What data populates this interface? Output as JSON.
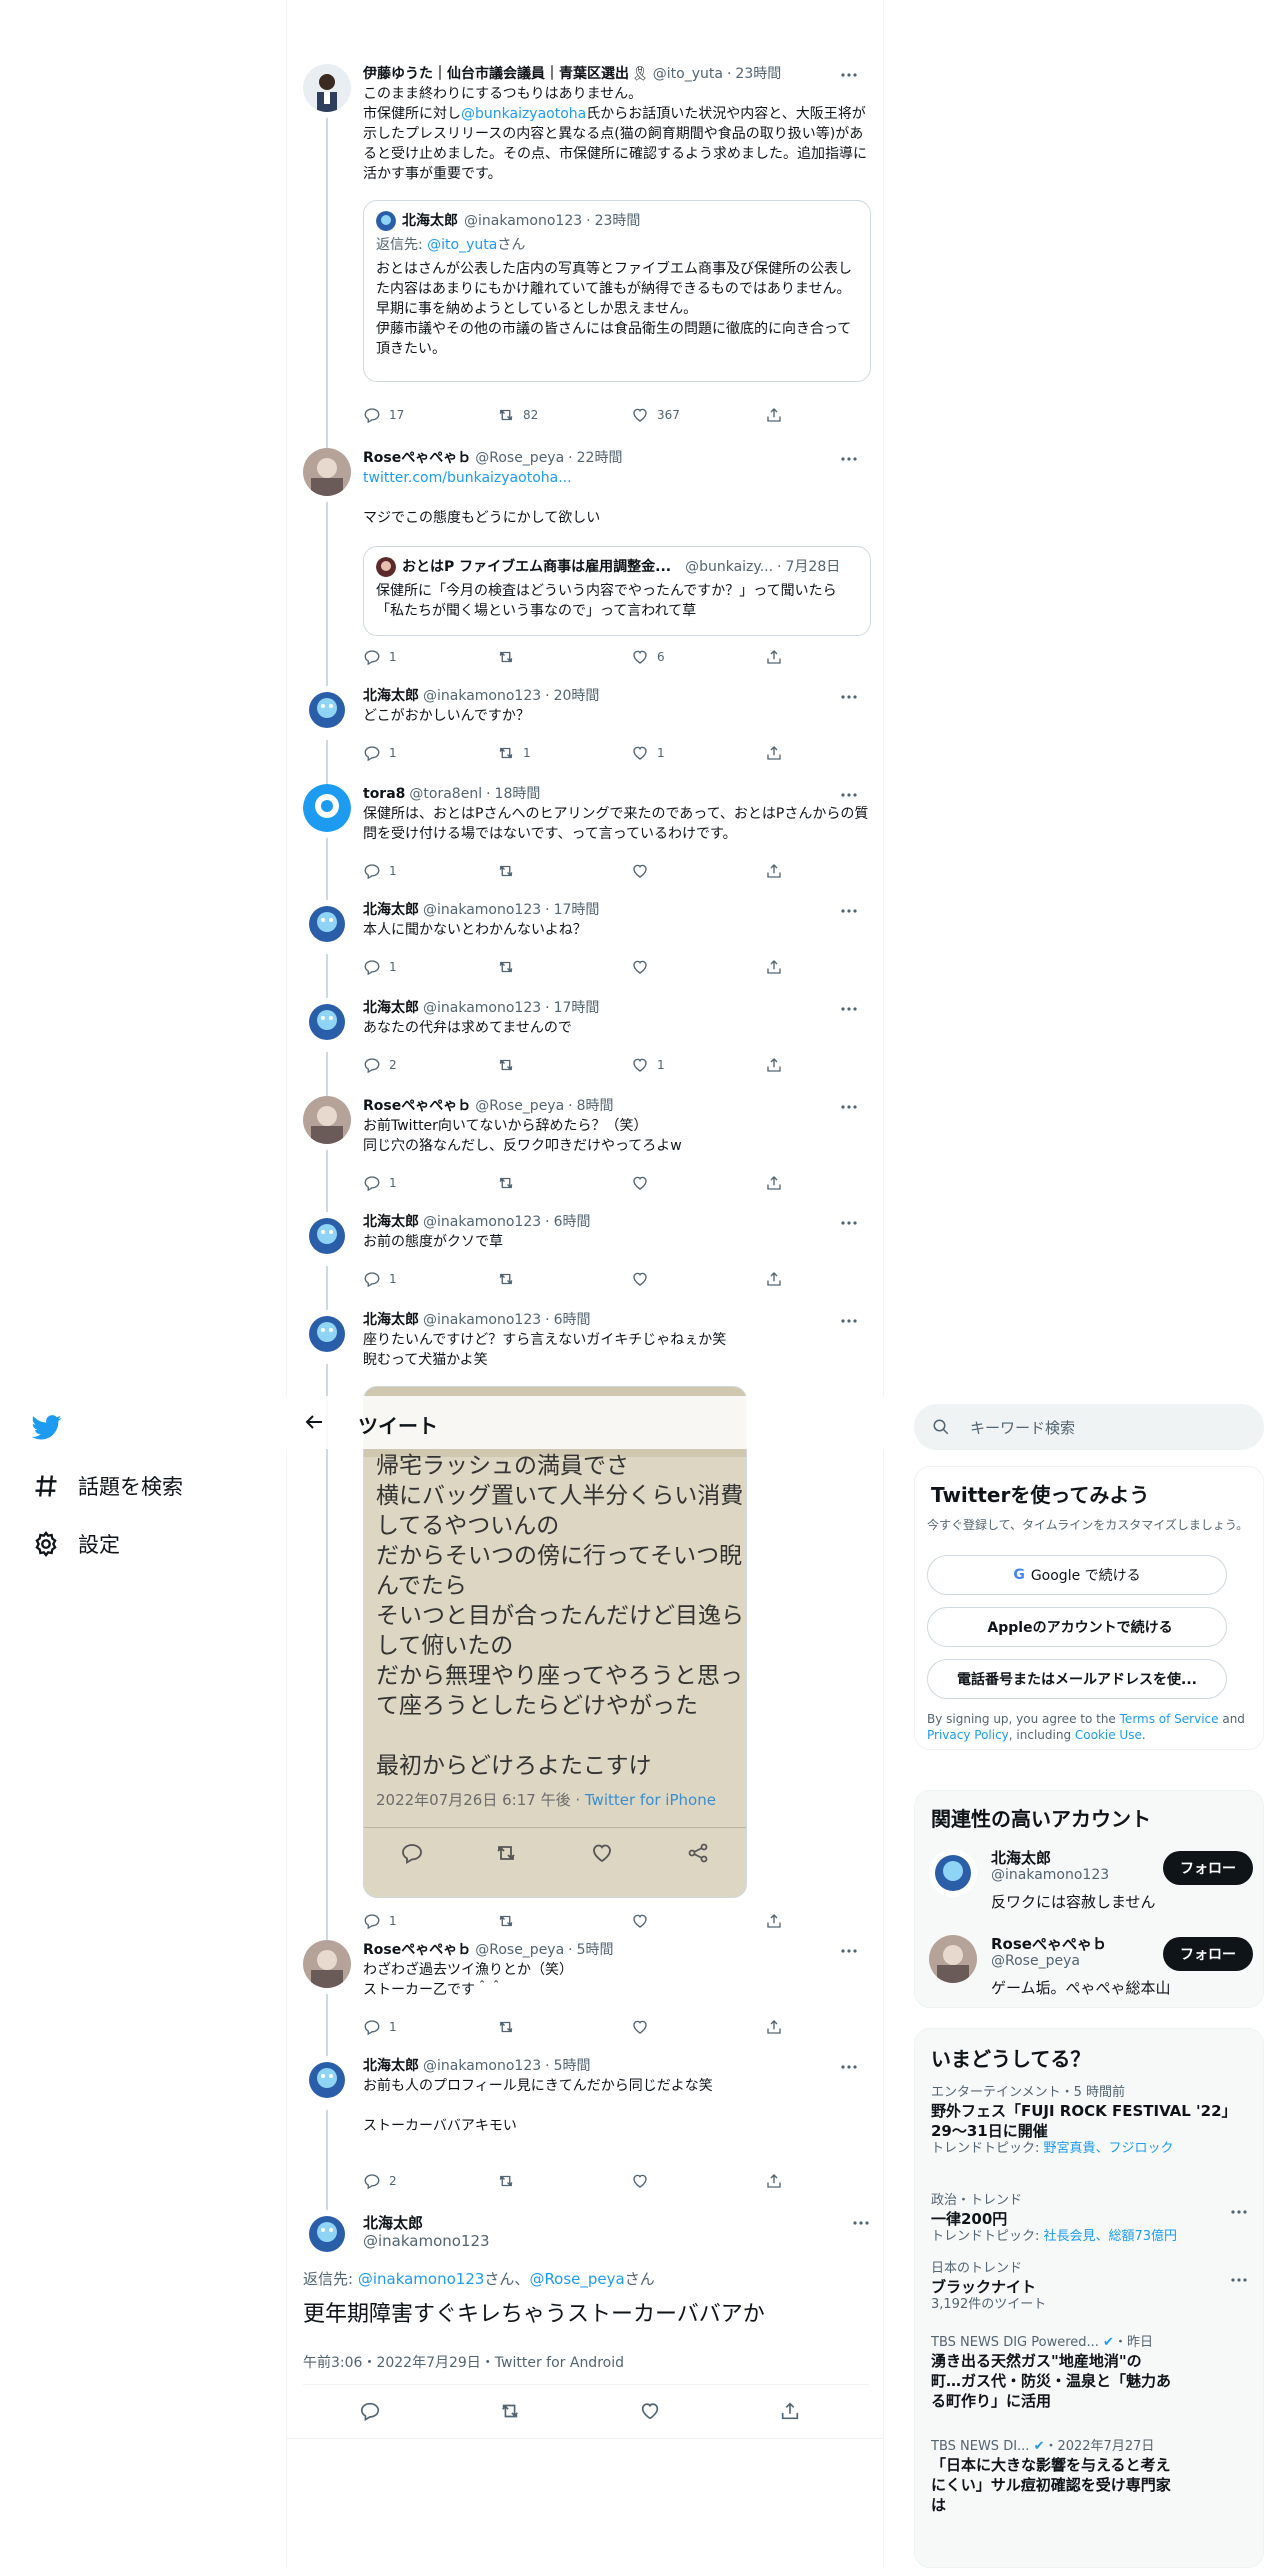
{
  "nav": {
    "explore": "話題を検索",
    "settings": "設定"
  },
  "header": {
    "title": "ツイート"
  },
  "tweets": [
    {
      "display_name": "伊藤ゆうた｜仙台市議会議員｜青葉区選出",
      "handle": "@ito_yuta",
      "time": "23時間",
      "text_1": "このまま終わりにするつもりはありません。\n市保健所に対し",
      "mention": "@bunkaizyaotoha",
      "text_2": "氏からお話頂いた状況や内容と、大阪王将が示したプレスリリースの内容と異なる点(猫の飼育期間や食品の取り扱い等)があると受け止めました。その点、市保健所に確認するよう求めました。追加指導に活かす事が重要です。",
      "quote": {
        "display_name": "北海太郎",
        "handle": "@inakamono123",
        "time": "23時間",
        "reply_label": "返信先: ",
        "reply_to": "@ito_yuta",
        "reply_suffix": "さん",
        "text": "おとはさんが公表した店内の写真等とファイブエム商事及び保健所の公表した内容はあまりにもかけ離れていて誰もが納得できるものではありません。\n早期に事を納めようとしているとしか思えません。\n伊藤市議やその他の市議の皆さんには食品衛生の問題に徹底的に向き合って頂きたい。"
      },
      "replies": "17",
      "retweets": "82",
      "likes": "367"
    },
    {
      "display_name": "Roseぺゃぺゃｂ",
      "handle": "@Rose_peya",
      "time": "22時間",
      "link": "twitter.com/bunkaizyaotoha...",
      "text": "マジでこの態度もどうにかして欲しい",
      "quote": {
        "display_name": "おとはP ファイブエム商事は雇用調整金...",
        "handle": "@bunkaizy...",
        "time": "7月28日",
        "text": "保健所に「今月の検査はどういう内容でやったんですか？」って聞いたら「私たちが聞く場という事なので」って言われて草"
      },
      "replies": "1",
      "retweets": "",
      "likes": "6"
    },
    {
      "display_name": "北海太郎",
      "handle": "@inakamono123",
      "time": "20時間",
      "text": "どこがおかしいんですか？",
      "replies": "1",
      "retweets": "1",
      "likes": "1"
    },
    {
      "display_name": "tora8",
      "handle": "@tora8enl",
      "time": "18時間",
      "text": "保健所は、おとはPさんへのヒアリングで来たのであって、おとはPさんからの質問を受け付ける場ではないです、って言っているわけです。",
      "replies": "1",
      "retweets": "",
      "likes": ""
    },
    {
      "display_name": "北海太郎",
      "handle": "@inakamono123",
      "time": "17時間",
      "text": "本人に聞かないとわかんないよね？",
      "replies": "1",
      "retweets": "",
      "likes": ""
    },
    {
      "display_name": "北海太郎",
      "handle": "@inakamono123",
      "time": "17時間",
      "text": "あなたの代弁は求めてませんので",
      "replies": "2",
      "retweets": "",
      "likes": "1"
    },
    {
      "display_name": "Roseぺゃぺゃｂ",
      "handle": "@Rose_peya",
      "time": "8時間",
      "text": "お前Twitter向いてないから辞めたら？（笑）\n同じ穴の狢なんだし、反ワク叩きだけやってろよw",
      "replies": "1",
      "retweets": "",
      "likes": ""
    },
    {
      "display_name": "北海太郎",
      "handle": "@inakamono123",
      "time": "6時間",
      "text": "お前の態度がクソで草",
      "replies": "1",
      "retweets": "",
      "likes": ""
    },
    {
      "display_name": "北海太郎",
      "handle": "@inakamono123",
      "time": "6時間",
      "text": "座りたいんですけど？すら言えないガイキチじゃねぇか笑\n睨むって犬猫かよ笑",
      "image_lines": [
        "帰宅ラッシュの満員でさ",
        "横にバッグ置いて人半分くらい消費",
        "してるやついんの",
        "だからそいつの傍に行ってそいつ睨",
        "んでたら",
        "そいつと目が合ったんだけど目逸ら",
        "して俯いたの",
        "だから無理やり座ってやろうと思っ",
        "て座ろうとしたらどけやがった",
        "",
        "最初からどけろよたこすけ"
      ],
      "image_timestamp": "2022年07月26日 6:17 午後 · ",
      "image_source": "Twitter for iPhone",
      "replies": "1",
      "retweets": "",
      "likes": ""
    },
    {
      "display_name": "Roseぺゃぺゃｂ",
      "handle": "@Rose_peya",
      "time": "5時間",
      "text": "わざわざ過去ツイ漁りとか（笑）\nストーカー乙です＾＾",
      "replies": "1",
      "retweets": "",
      "likes": ""
    },
    {
      "display_name": "北海太郎",
      "handle": "@inakamono123",
      "time": "5時間",
      "text": "お前も人のプロフィール見にきてんだから同じだよな笑\n\nストーカーババアキモい",
      "replies": "2",
      "retweets": "",
      "likes": ""
    }
  ],
  "main_tweet": {
    "display_name": "北海太郎",
    "handle": "@inakamono123",
    "reply_label": "返信先: ",
    "reply_to_1": "@inakamono123",
    "reply_mid": "さん、",
    "reply_to_2": "@Rose_peya",
    "reply_suffix": "さん",
    "text": "更年期障害すぐキレちゃうストーカーババアか",
    "meta": "午前3:06・2022年7月29日・Twitter for Android"
  },
  "right": {
    "search_placeholder": "キーワード検索",
    "signup": {
      "title": "Twitterを使ってみよう",
      "desc": "今すぐ登録して、タイムラインをカスタマイズしましょう。",
      "google": "Google で続ける",
      "apple": "Appleのアカウントで続ける",
      "phone": "電話番号またはメールアドレスを使...",
      "terms_1": "By signing up, you agree to the ",
      "terms_link": "Terms of Service",
      "terms_2": " and ",
      "privacy_link": "Privacy Policy",
      "terms_3": ", including ",
      "cookie_link": "Cookie Use",
      "terms_4": "."
    },
    "related": {
      "title": "関連性の高いアカウント",
      "accounts": [
        {
          "name": "北海太郎",
          "handle": "@inakamono123",
          "bio": "反ワクには容赦しません",
          "button": "フォロー"
        },
        {
          "name": "Roseぺゃぺゃｂ",
          "handle": "@Rose_peya",
          "bio": "ゲーム垢。ぺゃぺゃ総本山",
          "button": "フォロー"
        }
      ]
    },
    "trends": {
      "title": "いまどうしてる？",
      "items": [
        {
          "category": "エンターテインメント・5 時間前",
          "name": "野外フェス「FUJI ROCK FESTIVAL '22」29～31日に開催",
          "sub_label": "トレンドトピック: ",
          "sub_value": "野宮真貴、フジロック"
        },
        {
          "category": "政治・トレンド",
          "name": "一律200円",
          "sub_label": "トレンドトピック: ",
          "sub_value": "社長会見、総額73億円"
        },
        {
          "category": "日本のトレンド",
          "name": "ブラックナイト",
          "sub_label": "3,192件のツイート",
          "sub_value": ""
        },
        {
          "category": "TBS NEWS DIG Powered...",
          "time": "・昨日",
          "name": "湧き出る天然ガス\"地産地消\"の町…ガス代・防災・温泉と「魅力ある町作り」に活用"
        },
        {
          "category": "TBS NEWS DI...",
          "time": "・2022年7月27日",
          "name": "「日本に大きな影響を与えると考えにくい」サル痘初確認を受け専門家は"
        }
      ]
    }
  },
  "colors": {
    "accent": "#1d9bf0",
    "text": "#0f1419",
    "muted": "#536471",
    "border": "#cfd9de"
  }
}
